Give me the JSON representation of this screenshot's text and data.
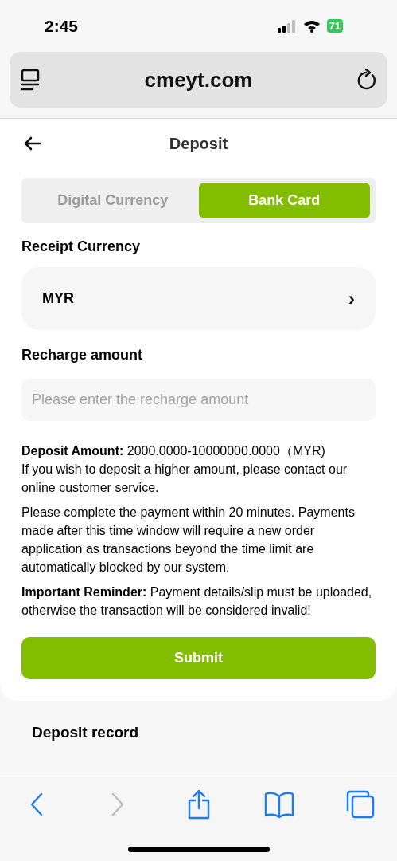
{
  "status_bar": {
    "time": "2:45",
    "battery": "71"
  },
  "browser": {
    "url": "cmeyt.com"
  },
  "header": {
    "title": "Deposit"
  },
  "tabs": [
    {
      "label": "Digital Currency",
      "selected": false
    },
    {
      "label": "Bank Card",
      "selected": true
    }
  ],
  "form": {
    "currency_label": "Receipt Currency",
    "currency_value": "MYR",
    "chevron": "›",
    "amount_label": "Recharge amount",
    "amount_placeholder": "Please enter the recharge amount"
  },
  "notes": [
    "**Deposit Amount:**  2000.0000-10000000.0000（MYR)\nIf you wish to deposit a higher amount, please contact our online customer service.",
    "Please complete the payment within 20 minutes. Payments made after this time window will require a new order application as transactions beyond the time limit are automatically blocked by our system.",
    "**Important Reminder:** Payment details/slip must be uploaded, otherwise the transaction will be considered invalid!"
  ],
  "submit": "Submit",
  "record_title": "Deposit record",
  "toolbar": [
    {
      "kind": "back",
      "disabled": false
    },
    {
      "kind": "forward",
      "disabled": true
    },
    {
      "kind": "share",
      "disabled": false
    },
    {
      "kind": "bookmarks",
      "disabled": false
    },
    {
      "kind": "tabs",
      "disabled": false
    }
  ]
}
